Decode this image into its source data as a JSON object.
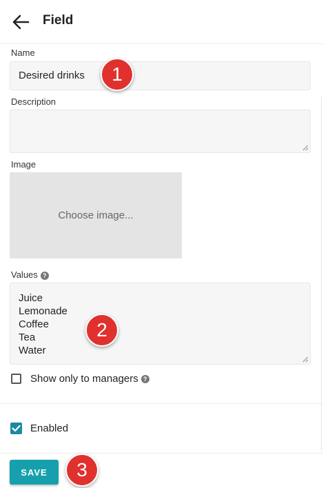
{
  "header": {
    "title": "Field"
  },
  "form": {
    "name_label": "Name",
    "name_value": "Desired drinks",
    "description_label": "Description",
    "description_value": "",
    "image_label": "Image",
    "image_button": "Choose image...",
    "values_label": "Values",
    "values_lines": [
      "Juice",
      "Lemonade",
      "Coffee",
      "Tea",
      "Water"
    ],
    "show_managers_label": "Show only to managers",
    "show_managers_checked": false,
    "enabled_label": "Enabled",
    "enabled_checked": true
  },
  "actions": {
    "save_label": "SAVE"
  },
  "annotations": [
    "1",
    "2",
    "3"
  ],
  "colors": {
    "accent": "#16a0ad",
    "checkbox": "#1a8aa3",
    "badge": "#e0312f"
  }
}
